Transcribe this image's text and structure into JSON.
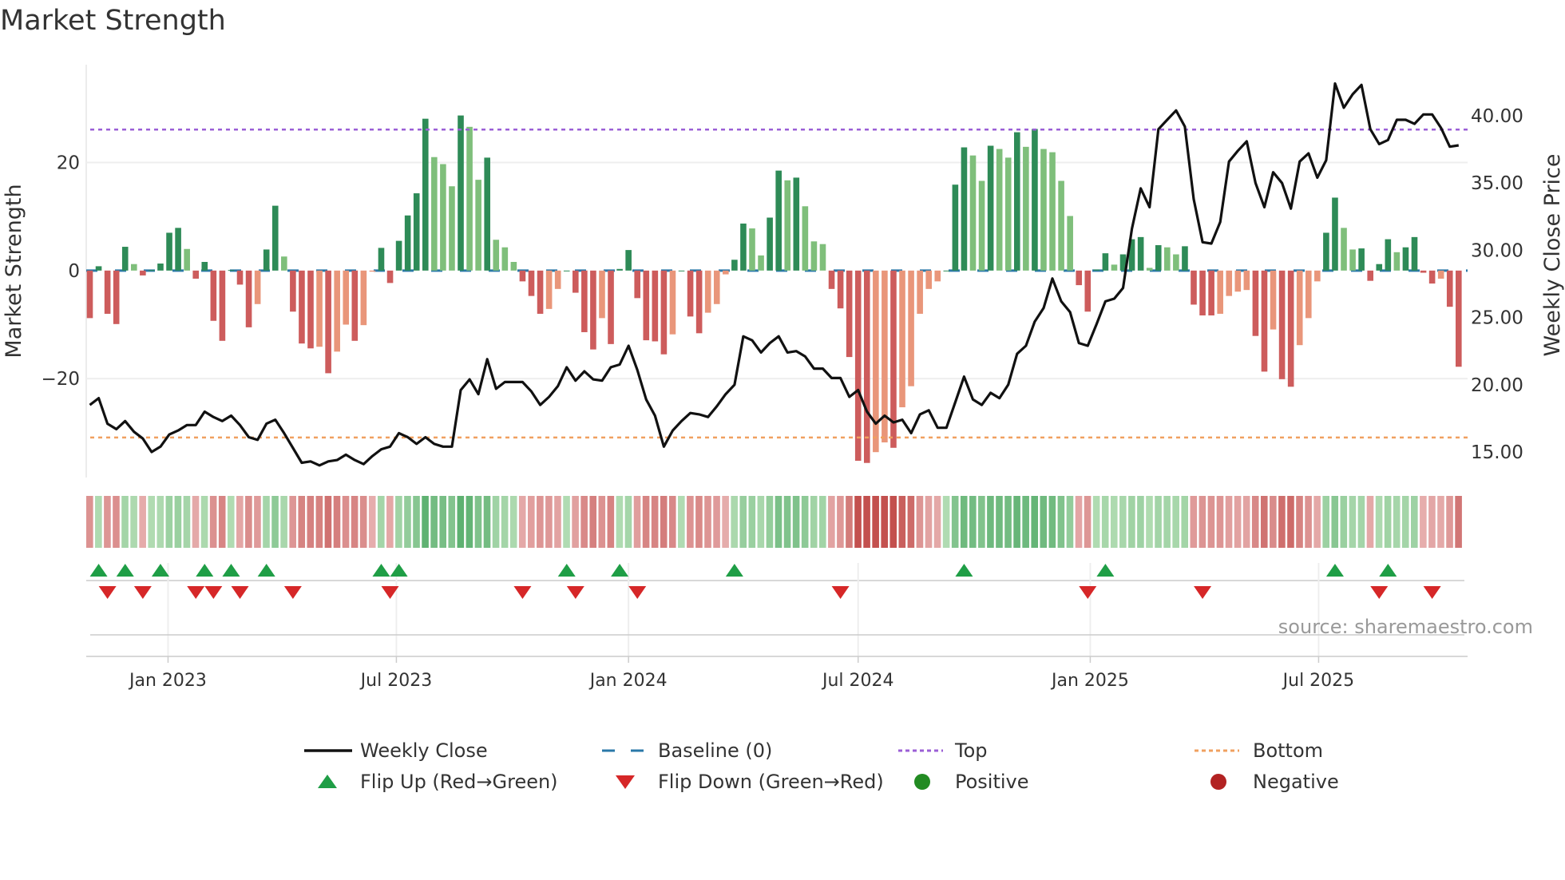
{
  "title": "Market Strength",
  "source": "source: sharemaestro.com",
  "colors": {
    "up_strong": "#2e8b57",
    "up_weak": "#7fbf7b",
    "down_strong": "#cd5c5c",
    "down_weak": "#e9967a",
    "close": "#111111",
    "baseline": "#2a78a8",
    "top": "#9b5fd6",
    "bottom": "#f0a060",
    "flip_up": "#1f9e46",
    "flip_down": "#d62728",
    "positive": "#228b22",
    "negative": "#b22222"
  },
  "chart_data": {
    "type": "bar+line",
    "title": "Market Strength",
    "start_date": "2022-10-31",
    "interval": "weekly",
    "ylabel_left": "Market Strength",
    "ylabel_right": "Weekly Close Price",
    "ylim_left": [
      -38.3,
      38.1
    ],
    "ylim_right": [
      13.1,
      43.8
    ],
    "left_ticks": [
      {
        "v": 20,
        "label": "20"
      },
      {
        "v": 0,
        "label": "0"
      },
      {
        "v": -20,
        "label": "−20"
      }
    ],
    "right_ticks": [
      {
        "v": 40,
        "label": "40.00"
      },
      {
        "v": 35,
        "label": "35.00"
      },
      {
        "v": 30,
        "label": "30.00"
      },
      {
        "v": 25,
        "label": "25.00"
      },
      {
        "v": 20,
        "label": "20.00"
      },
      {
        "v": 15,
        "label": "15.00"
      }
    ],
    "x_ticks": [
      {
        "date": "2023-01-01",
        "label": "Jan 2023"
      },
      {
        "date": "2023-07-01",
        "label": "Jul 2023"
      },
      {
        "date": "2024-01-01",
        "label": "Jan 2024"
      },
      {
        "date": "2024-07-01",
        "label": "Jul 2024"
      },
      {
        "date": "2025-01-01",
        "label": "Jan 2025"
      },
      {
        "date": "2025-07-01",
        "label": "Jul 2025"
      }
    ],
    "top_level": 26.1,
    "bottom_level": -30.9,
    "strength": [
      -8.8,
      0.8,
      -8,
      -9.9,
      4.4,
      1.2,
      -0.9,
      0.1,
      1.3,
      7,
      7.9,
      4,
      -1.5,
      1.6,
      -9.3,
      -13,
      0.1,
      -2.6,
      -10.5,
      -6.2,
      3.9,
      12,
      2.6,
      -7.6,
      -13.5,
      -14.4,
      -14.1,
      -19,
      -15,
      -10,
      -13,
      -10.1,
      -0.2,
      4.2,
      -2.3,
      5.5,
      10.2,
      14.3,
      28.1,
      21,
      19.7,
      15.6,
      28.7,
      26.6,
      16.8,
      20.9,
      5.7,
      4.3,
      1.6,
      -2,
      -4.7,
      -8,
      -7.1,
      -3.4,
      0,
      -4.1,
      -11.4,
      -14.6,
      -8.8,
      -13.6,
      0.3,
      3.8,
      -5.1,
      -12.9,
      -13.1,
      -15.5,
      -11.8,
      0,
      -8.5,
      -11.6,
      -7.8,
      -6.2,
      -0.7,
      2,
      8.7,
      7.8,
      2.8,
      9.8,
      18.5,
      16.7,
      17.2,
      11.9,
      5.4,
      4.9,
      -3.4,
      -7,
      -16,
      -35.2,
      -35.6,
      -33.6,
      -31.8,
      -32.8,
      -25.3,
      -21.4,
      -8,
      -3.4,
      -2,
      0,
      15.9,
      22.8,
      21.3,
      16.6,
      23.1,
      22.5,
      20.9,
      25.6,
      22.9,
      26.2,
      22.5,
      21.9,
      16.6,
      10.1,
      -2.7,
      -7.6,
      0.2,
      3.2,
      1.1,
      3,
      5.8,
      6.2,
      0.5,
      4.7,
      4.3,
      3,
      4.5,
      -6.3,
      -8.3,
      -8.3,
      -8,
      -4.7,
      -3.9,
      -3.6,
      -12.1,
      -18.7,
      -10.9,
      -20.1,
      -21.5,
      -13.8,
      -8.8,
      -2,
      7,
      13.5,
      7.9,
      3.9,
      4.1,
      -1.9,
      1.2,
      5.8,
      3.4,
      4.3,
      6.2,
      -0.4,
      -2.4,
      -1.5,
      -6.7,
      -17.8
    ],
    "close": [
      18.5,
      19.0,
      17.1,
      16.7,
      17.3,
      16.5,
      16.0,
      15.0,
      15.4,
      16.3,
      16.6,
      17.0,
      17.0,
      18.0,
      17.6,
      17.3,
      17.7,
      17.0,
      16.1,
      15.9,
      17.1,
      17.4,
      16.4,
      15.3,
      14.2,
      14.3,
      14.0,
      14.3,
      14.4,
      14.8,
      14.4,
      14.1,
      14.7,
      15.2,
      15.4,
      16.4,
      16.1,
      15.6,
      16.1,
      15.6,
      15.4,
      15.4,
      19.6,
      20.4,
      19.3,
      21.9,
      19.7,
      20.2,
      20.2,
      20.2,
      19.5,
      18.5,
      19.1,
      19.9,
      21.3,
      20.3,
      21.0,
      20.4,
      20.3,
      21.3,
      21.5,
      22.9,
      21.1,
      18.9,
      17.7,
      15.4,
      16.6,
      17.3,
      17.9,
      17.8,
      17.6,
      18.4,
      19.3,
      20.0,
      23.6,
      23.3,
      22.4,
      23.1,
      23.6,
      22.4,
      22.5,
      22.1,
      21.2,
      21.2,
      20.5,
      20.5,
      19.1,
      19.6,
      18.0,
      17.1,
      17.7,
      17.2,
      17.4,
      16.4,
      17.8,
      18.1,
      16.8,
      16.8,
      18.7,
      20.6,
      18.9,
      18.5,
      19.4,
      19.0,
      20.0,
      22.3,
      22.9,
      24.7,
      25.7,
      27.9,
      26.2,
      25.4,
      23.1,
      22.9,
      24.5,
      26.2,
      26.4,
      27.2,
      31.6,
      34.6,
      33.2,
      39.0,
      39.7,
      40.4,
      39.2,
      33.8,
      30.6,
      30.5,
      32.1,
      36.6,
      37.4,
      38.1,
      35.0,
      33.2,
      35.8,
      35.0,
      33.1,
      36.6,
      37.2,
      35.4,
      36.7,
      42.4,
      40.6,
      41.6,
      42.3,
      39.0,
      37.9,
      38.2,
      39.7,
      39.7,
      39.4,
      40.1,
      40.1,
      39.1,
      37.7,
      37.8
    ],
    "flip_up_weeks": [
      1,
      4,
      8,
      13,
      16,
      20,
      33,
      35,
      54,
      60,
      73,
      99,
      115,
      141,
      147
    ],
    "flip_down_weeks": [
      2,
      6,
      12,
      14,
      17,
      23,
      34,
      49,
      55,
      62,
      85,
      113,
      126,
      146,
      152
    ],
    "legend": [
      {
        "key": "close",
        "label": "Weekly Close"
      },
      {
        "key": "baseline",
        "label": "Baseline (0)"
      },
      {
        "key": "top",
        "label": "Top"
      },
      {
        "key": "bottom",
        "label": "Bottom"
      },
      {
        "key": "flip_up",
        "label": "Flip Up (Red→Green)"
      },
      {
        "key": "flip_down",
        "label": "Flip Down (Green→Red)"
      },
      {
        "key": "positive",
        "label": "Positive"
      },
      {
        "key": "negative",
        "label": "Negative"
      }
    ],
    "legend_placement": "bottom"
  }
}
